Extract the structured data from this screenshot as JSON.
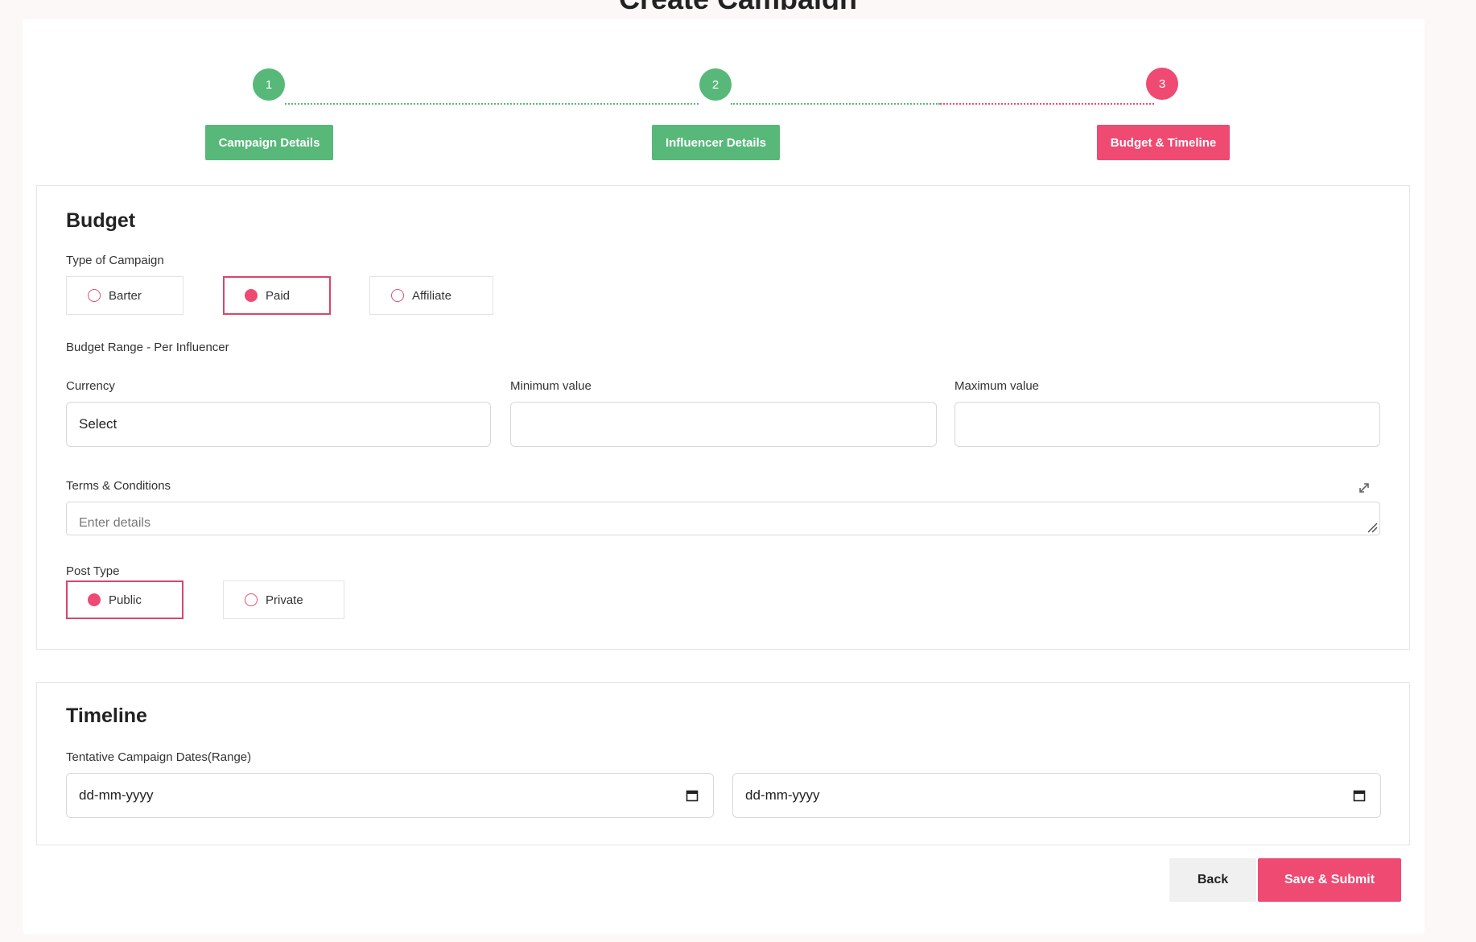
{
  "page_title": "Create Campaign",
  "stepper": {
    "steps": [
      {
        "number": "1",
        "label": "Campaign Details",
        "status": "complete"
      },
      {
        "number": "2",
        "label": "Influencer Details",
        "status": "complete"
      },
      {
        "number": "3",
        "label": "Budget & Timeline",
        "status": "active"
      }
    ],
    "colors": {
      "complete": "#57b879",
      "active": "#ef4a72"
    }
  },
  "budget": {
    "title": "Budget",
    "campaign_type_label": "Type of Campaign",
    "campaign_types": [
      {
        "label": "Barter",
        "selected": false
      },
      {
        "label": "Paid",
        "selected": true
      },
      {
        "label": "Affiliate",
        "selected": false
      }
    ],
    "budget_range_label": "Budget Range - Per Influencer",
    "currency_label": "Currency",
    "currency_value": "Select",
    "min_label": "Minimum value",
    "min_value": "",
    "max_label": "Maximum value",
    "max_value": "",
    "terms_label": "Terms & Conditions",
    "terms_placeholder": "Enter details",
    "post_type_label": "Post Type",
    "post_types": [
      {
        "label": "Public",
        "selected": true
      },
      {
        "label": "Private",
        "selected": false
      }
    ]
  },
  "timeline": {
    "title": "Timeline",
    "dates_label": "Tentative Campaign Dates(Range)",
    "start_placeholder": "dd-mm-yyyy",
    "end_placeholder": "dd-mm-yyyy"
  },
  "actions": {
    "back_label": "Back",
    "save_label": "Save & Submit"
  },
  "accent_color": "#ef4a72"
}
